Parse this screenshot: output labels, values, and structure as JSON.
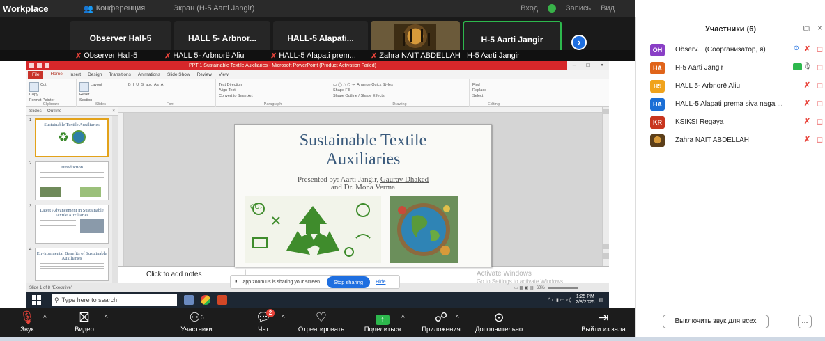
{
  "zoom": {
    "app_title": "Workplace",
    "top_items": [
      "Конференция",
      "Экран (H-5 Aarti Jangir)"
    ],
    "top_right": [
      "Вход",
      "Запись",
      "Вид"
    ],
    "video_tiles": [
      {
        "name": "Observer  Hall-5"
      },
      {
        "name": "HALL 5- Arbnor..."
      },
      {
        "name": "HALL-5 Alapati..."
      },
      {
        "name": ""
      },
      {
        "name": "H-5 Aarti Jangir"
      }
    ],
    "name_strip": [
      "Observer  Hall-5",
      "HALL 5- Arbnorë Aliu",
      "HALL-5 Alapati prem...",
      "Zahra NAIT ABDELLAH",
      "H-5 Aarti Jangir"
    ],
    "next_arrow": "›"
  },
  "ppt": {
    "window_title": "PPT 1 Sustainable Textile Auxiliaries - Microsoft PowerPoint (Product Activation Failed)",
    "tabs": [
      "File",
      "Home",
      "Insert",
      "Design",
      "Transitions",
      "Animations",
      "Slide Show",
      "Review",
      "View"
    ],
    "ribbon_groups": [
      "Clipboard",
      "Slides",
      "Font",
      "Paragraph",
      "Drawing",
      "Editing"
    ],
    "ribbon_bits": {
      "clipboard": [
        "Cut",
        "Copy",
        "Format Painter",
        "Paste"
      ],
      "slides": [
        "Layout",
        "Reset",
        "New Slide",
        "Section"
      ],
      "paragraph": [
        "Text Direction",
        "Align Text",
        "Convert to SmartArt"
      ],
      "drawing": [
        "Shape Fill",
        "Shape Outline",
        "Shape Effects",
        "Arrange",
        "Quick Styles"
      ],
      "editing": [
        "Find",
        "Replace",
        "Select"
      ]
    },
    "pane_tabs": [
      "Slides",
      "Outline"
    ],
    "pane_close": "×",
    "thumbs": [
      {
        "num": "1",
        "title": "Sustainable Textile Auxiliaries"
      },
      {
        "num": "2",
        "title": "Introduction"
      },
      {
        "num": "3",
        "title": "Latest Advancement in Sustainable Textile Auxiliaries"
      },
      {
        "num": "4",
        "title": "Environmental Benefits of Sustainable Auxiliaries"
      }
    ],
    "slide": {
      "title_line1": "Sustainable Textile",
      "title_line2": "Auxiliaries",
      "presented_by": "Presented by: Aarti Jangir, ",
      "presenter_underlined": "Gaurav Dhaked",
      "and_line": "and Dr. Mona Verma"
    },
    "notes_placeholder": "Click to add notes",
    "status_left": "Slide 1 of 8   \"Executive\"",
    "zoom_level": "60%"
  },
  "share_banner": {
    "text": "app.zoom.us is sharing your screen.",
    "stop": "Stop sharing",
    "hide": "Hide"
  },
  "activate": {
    "line1": "Activate Windows",
    "line2": "Go to Settings to activate Windows."
  },
  "taskbar": {
    "search_placeholder": "Type here to search",
    "time": "1:25 PM",
    "date": "2/8/2025"
  },
  "toolbar": {
    "buttons": [
      {
        "label": "Звук",
        "icon": "mic-muted-icon"
      },
      {
        "label": "Видео",
        "icon": "video-off-icon"
      },
      {
        "label": "Участники",
        "icon": "participants-icon",
        "count": "6"
      },
      {
        "label": "Чат",
        "icon": "chat-icon",
        "badge": "2"
      },
      {
        "label": "Отреагировать",
        "icon": "heart-icon"
      },
      {
        "label": "Поделиться",
        "icon": "share-icon"
      },
      {
        "label": "Приложения",
        "icon": "apps-icon"
      },
      {
        "label": "Дополнительно",
        "icon": "more-icon"
      },
      {
        "label": "Выйти из зала",
        "icon": "leave-icon"
      }
    ]
  },
  "panel": {
    "title": "Участники (6)",
    "participants": [
      {
        "initials": "OH",
        "color": "#8a3fc6",
        "name": "Observ... (Соорганизатор, я)"
      },
      {
        "initials": "HA",
        "color": "#e0641a",
        "name": "H-5 Aarti Jangir"
      },
      {
        "initials": "H5",
        "color": "#f0a31c",
        "name": "HALL 5- Arbnorë Aliu"
      },
      {
        "initials": "HA",
        "color": "#1b6fd6",
        "name": "HALL-5 Alapati prema siva naga ..."
      },
      {
        "initials": "KR",
        "color": "#c8361f",
        "name": "KSIKSI Regaya"
      },
      {
        "initials": "",
        "color": "#7a5a2a",
        "name": "Zahra NAIT ABDELLAH"
      }
    ],
    "mute_all": "Выключить звук для всех",
    "more": "..."
  },
  "colors": {
    "zoom_dark": "#1c1c1c",
    "accent_green": "#2db84d",
    "accent_blue": "#1f6fe0",
    "muted_red": "#e8433a",
    "slide_title": "#3a5a7c"
  }
}
